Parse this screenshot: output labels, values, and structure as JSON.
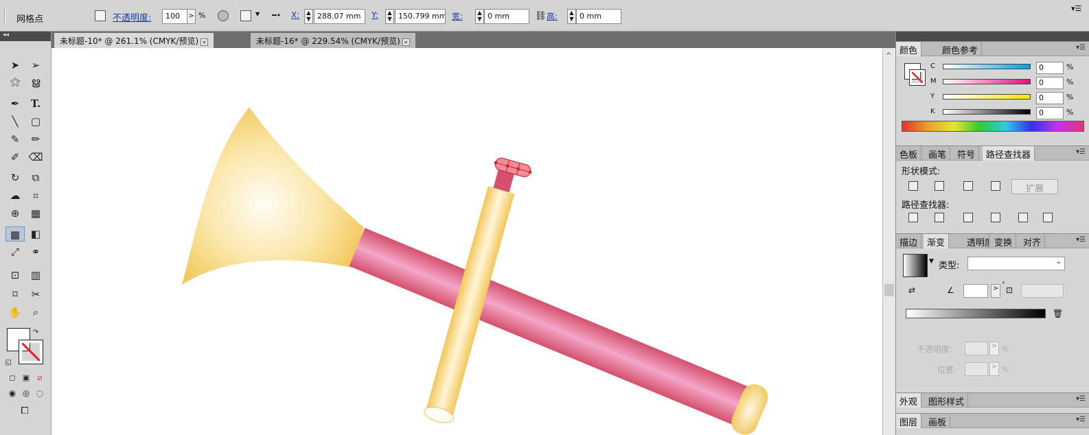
{
  "control_bar": {
    "mode": "网格点",
    "opacity_label": "不透明度:",
    "opacity_value": "100",
    "opacity_unit": "%",
    "x_label": "X:",
    "x_value": "288.07 mm",
    "y_label": "Y:",
    "y_value": "150.799 mm",
    "w_label": "宽:",
    "w_value": "0 mm",
    "h_label": "高:",
    "h_value": "0 mm"
  },
  "doc_tabs": [
    {
      "label": "未标题-10* @ 261.1% (CMYK/预览)"
    },
    {
      "label": "未标题-16* @ 229.54% (CMYK/预览)"
    }
  ],
  "color_panel": {
    "tabs": [
      "颜色",
      "颜色参考"
    ],
    "channels": [
      {
        "name": "C",
        "value": "0"
      },
      {
        "name": "M",
        "value": "0"
      },
      {
        "name": "Y",
        "value": "0"
      },
      {
        "name": "K",
        "value": "0"
      }
    ],
    "unit": "%"
  },
  "pathfinder_panel": {
    "tabs": [
      "色板",
      "画笔",
      "符号",
      "路径查找器"
    ],
    "shape_modes": "形状模式:",
    "expand": "扩展",
    "pathfinders": "路径查找器:"
  },
  "gradient_panel": {
    "tabs": [
      "描边",
      "渐变",
      "透明度",
      "变换",
      "对齐"
    ],
    "type_label": "类型:",
    "opacity_label": "不透明度:",
    "location_label": "位置:",
    "unit": "%"
  },
  "appearance_panel": {
    "tabs": [
      "外观",
      "图形样式"
    ]
  },
  "layers_panel": {
    "tabs": [
      "图层",
      "画板"
    ]
  },
  "colors": {
    "horn_light": "#fff8e6",
    "horn_dark": "#f2c75a",
    "tube_light": "#f5a6c8",
    "tube_dark": "#d4506c",
    "accent": "#1a3aa8"
  }
}
